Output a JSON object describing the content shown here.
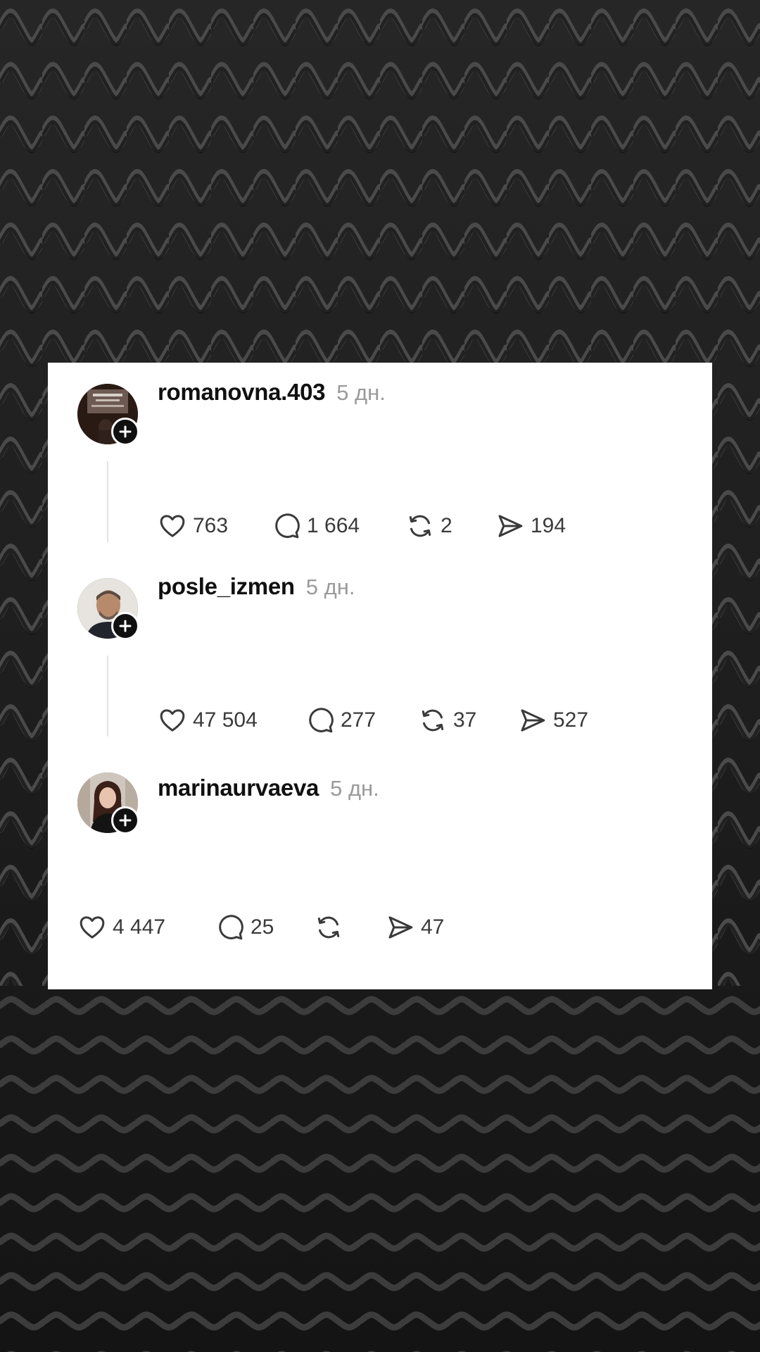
{
  "posts": [
    {
      "username": "romanovna.403",
      "time": "5 дн.",
      "stats": {
        "likes": "763",
        "comments": "1 664",
        "reposts": "2",
        "shares": "194"
      }
    },
    {
      "username": "posle_izmen",
      "time": "5 дн.",
      "stats": {
        "likes": "47 504",
        "comments": "277",
        "reposts": "37",
        "shares": "527"
      }
    },
    {
      "username": "marinaurvaeva",
      "time": "5 дн.",
      "stats": {
        "likes": "4 447",
        "comments": "25",
        "reposts": "",
        "shares": "47"
      }
    }
  ],
  "icons": {
    "like": "heart-icon",
    "comment": "comment-bubble-icon",
    "repost": "repost-icon",
    "share": "send-icon",
    "follow": "plus-icon"
  },
  "colors": {
    "card_background": "#ffffff",
    "text_primary": "#101010",
    "text_secondary": "#9a9a9a",
    "icon": "#3a3a3a"
  }
}
